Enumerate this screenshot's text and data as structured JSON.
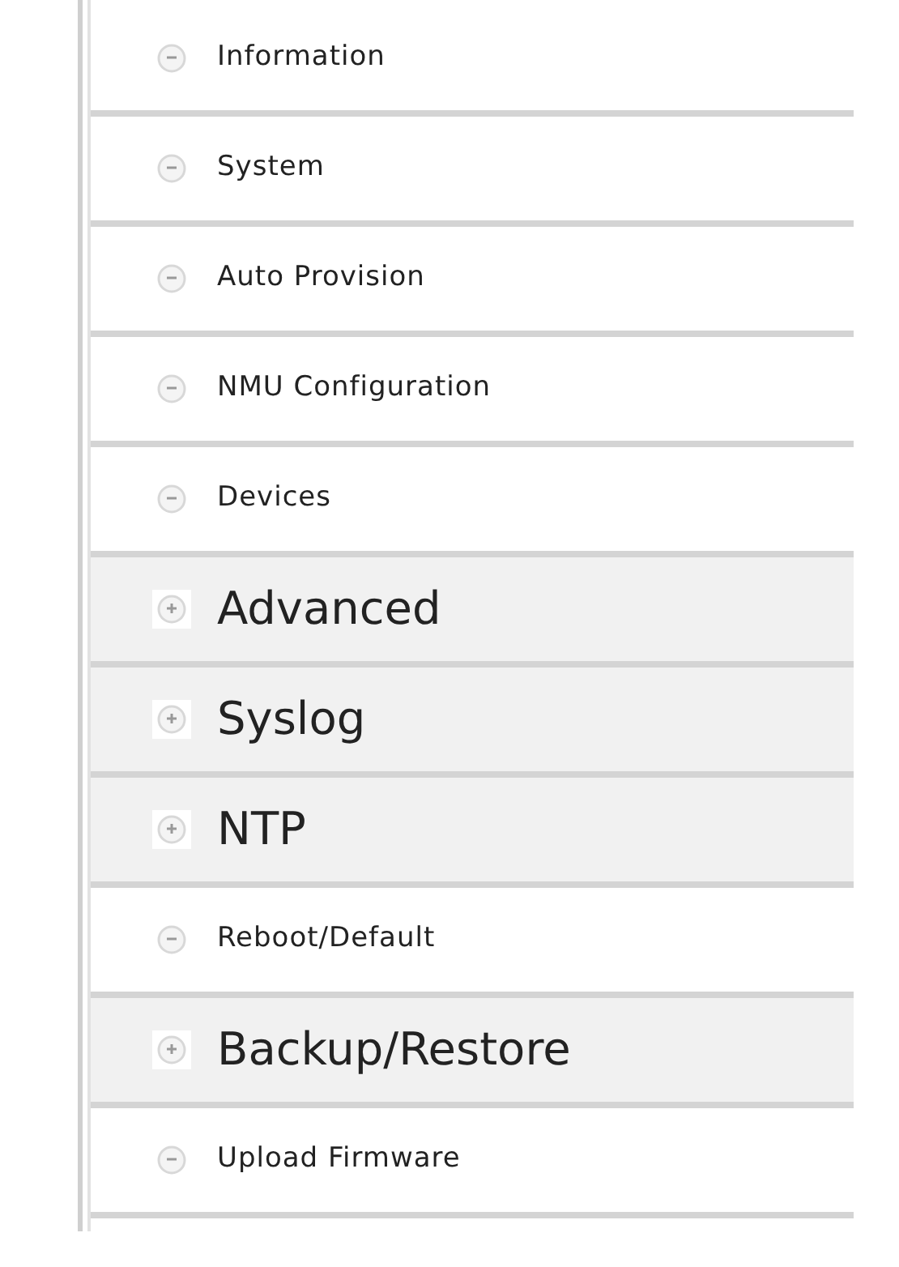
{
  "menu": {
    "items": [
      {
        "label": "Information",
        "expanded": true
      },
      {
        "label": "System",
        "expanded": true
      },
      {
        "label": "Auto Provision",
        "expanded": true
      },
      {
        "label": "NMU Configuration",
        "expanded": true
      },
      {
        "label": "Devices",
        "expanded": true
      },
      {
        "label": "Advanced",
        "expanded": false
      },
      {
        "label": "Syslog",
        "expanded": false
      },
      {
        "label": "NTP",
        "expanded": false
      },
      {
        "label": "Reboot/Default",
        "expanded": true
      },
      {
        "label": "Backup/Restore",
        "expanded": false
      },
      {
        "label": "Upload Firmware",
        "expanded": true
      }
    ]
  }
}
